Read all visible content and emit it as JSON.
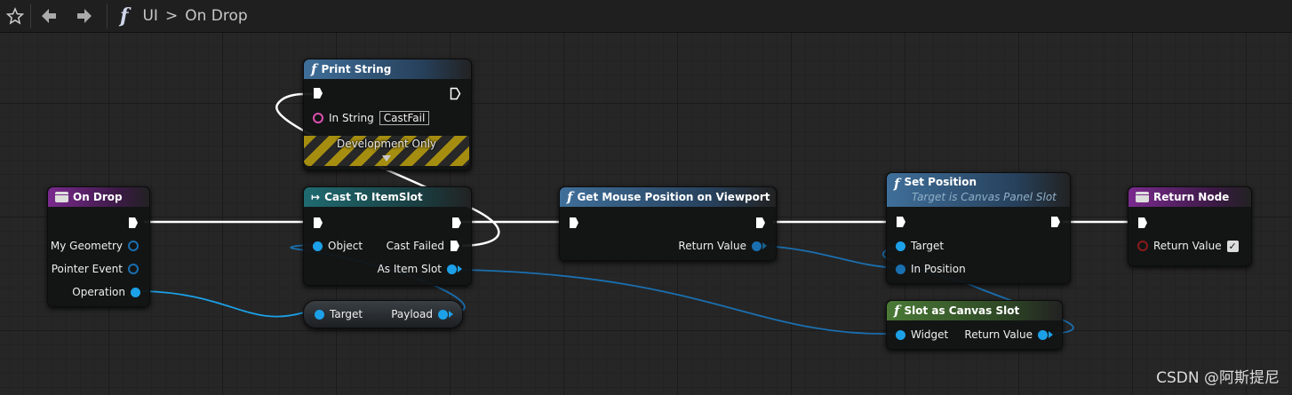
{
  "toolbar": {
    "star_icon": "star-icon",
    "back_icon": "arrow-left-icon",
    "forward_icon": "arrow-right-icon",
    "function_icon": "f",
    "breadcrumb_root": "UI",
    "breadcrumb_sep": ">",
    "breadcrumb_current": "On Drop"
  },
  "nodes": {
    "print_string": {
      "title": "Print String",
      "in_string_label": "In String",
      "in_string_value": "CastFail",
      "dev_label": "Development Only"
    },
    "on_drop": {
      "title": "On Drop",
      "pins": [
        "My Geometry",
        "Pointer Event",
        "Operation"
      ]
    },
    "cast": {
      "title": "Cast To ItemSlot",
      "object": "Object",
      "cast_failed": "Cast Failed",
      "as_item_slot": "As Item Slot"
    },
    "payload": {
      "target": "Target",
      "payload": "Payload"
    },
    "mouse_pos": {
      "title": "Get Mouse Position on Viewport",
      "return_value": "Return Value"
    },
    "set_position": {
      "title": "Set Position",
      "subtitle": "Target is Canvas Panel Slot",
      "target": "Target",
      "in_position": "In Position"
    },
    "slot_as_canvas": {
      "title": "Slot as Canvas Slot",
      "widget": "Widget",
      "return_value": "Return Value"
    },
    "return_node": {
      "title": "Return Node",
      "return_value": "Return Value"
    }
  },
  "colors": {
    "event_header": "#7a2a8e",
    "cast_header": "#1f6b71",
    "function_header": "#3f6f9a",
    "pure_header": "#4a7a36",
    "object_pin": "#1ca1e8",
    "exec_wire": "#ffffff"
  },
  "watermark": "CSDN @阿斯提尼"
}
